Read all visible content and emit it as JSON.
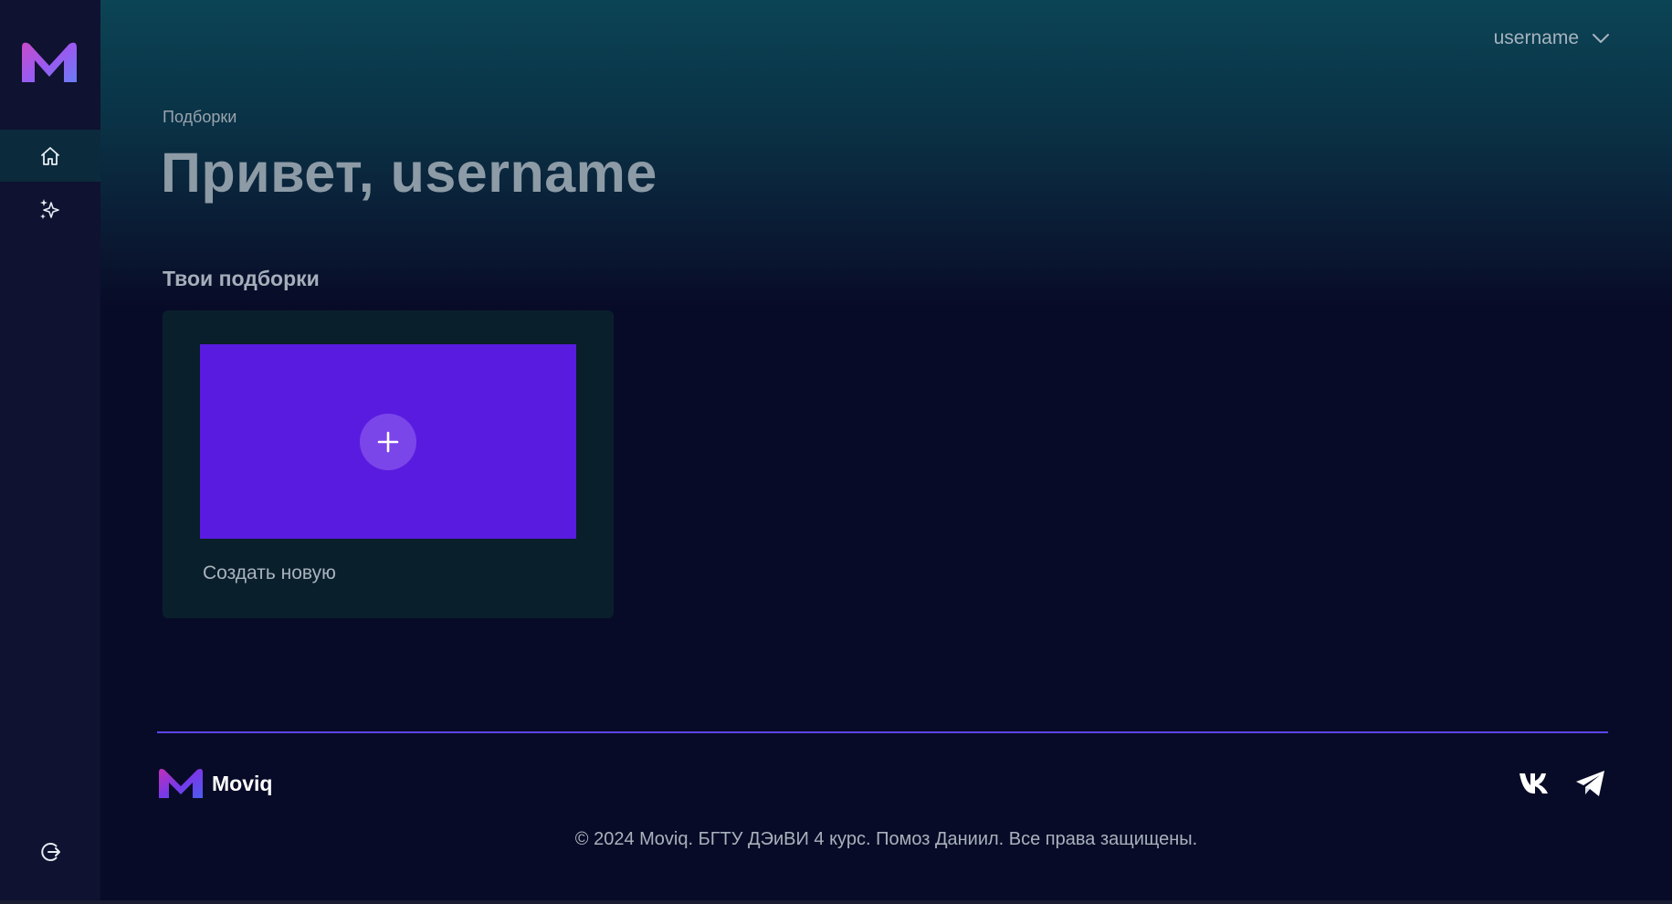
{
  "user": {
    "name": "username"
  },
  "page": {
    "breadcrumb": "Подборки",
    "title": "Привет, username"
  },
  "collections": {
    "section_title": "Твои подборки",
    "create_label": "Создать новую"
  },
  "footer": {
    "brand": "Moviq",
    "copyright": "© 2024 Moviq. БГТУ ДЭиВИ 4 курс. Помоз Даниил. Все права защищены."
  },
  "icons": {
    "logo": "moviq-m-logo",
    "home": "home-icon",
    "recommendations": "sparkle-icon",
    "logout": "logout-icon",
    "dropdown": "chevron-down-icon",
    "add": "plus-icon",
    "vk": "vk-icon",
    "telegram": "telegram-icon"
  },
  "colors": {
    "background": "#080b27",
    "sidebar": "#0f1230",
    "accent": "#5a1be0",
    "footer_line": "#5d45f0"
  }
}
